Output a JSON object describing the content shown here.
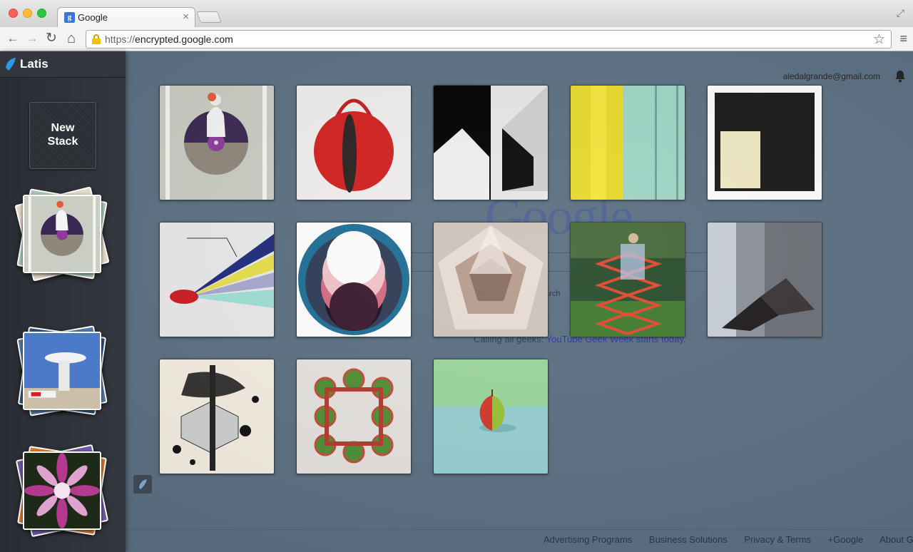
{
  "browser": {
    "tab_title": "Google",
    "tab_close": "×",
    "favicon_letter": "g",
    "url_scheme": "https://",
    "url_host": "encrypted.google.com",
    "back": "←",
    "forward": "→",
    "reload": "↻",
    "home": "⌂",
    "star": "☆",
    "menu": "≡",
    "fullscreen": "⤢"
  },
  "sidebar": {
    "app_name": "Latis",
    "new_stack_label": "New\nStack",
    "stacks": [
      {
        "name": "fashion-illustration"
      },
      {
        "name": "architecture"
      },
      {
        "name": "flowers"
      }
    ]
  },
  "account": {
    "email": "aledalgrande@gmail.com"
  },
  "background_page": {
    "logo": "Google",
    "search_button_fragment": "arch",
    "promo_prefix": "Calling all geeks: ",
    "promo_link": "YouTube Geek Week starts today."
  },
  "footer": {
    "links": [
      "Advertising Programs",
      "Business Solutions",
      "Privacy & Terms",
      "+Google",
      "About Go"
    ]
  },
  "grid": {
    "tiles": [
      {
        "name": "woman-vinyl-illustration"
      },
      {
        "name": "red-round-handbag"
      },
      {
        "name": "bw-architecture"
      },
      {
        "name": "yellow-mint-stripes"
      },
      {
        "name": "black-square-cream-block"
      },
      {
        "name": "red-lips-prism"
      },
      {
        "name": "pink-circle-rings"
      },
      {
        "name": "crystal-prism"
      },
      {
        "name": "woman-in-boxes-forest"
      },
      {
        "name": "dark-geometric-corner"
      },
      {
        "name": "ink-splash-sculpture"
      },
      {
        "name": "watermelon-square"
      },
      {
        "name": "red-green-apple"
      }
    ]
  }
}
